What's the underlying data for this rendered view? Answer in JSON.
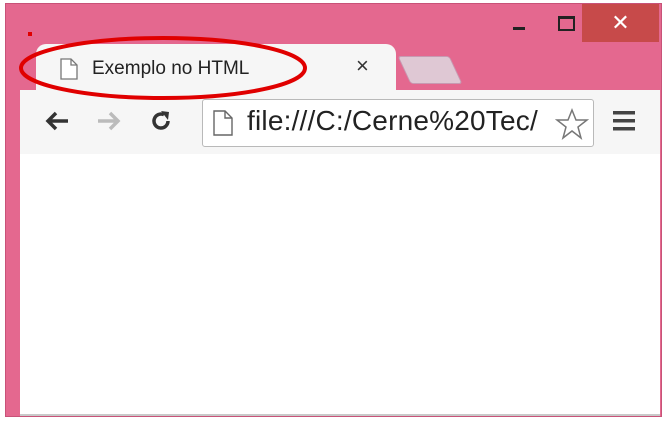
{
  "window": {
    "frame_color": "#e4688f",
    "close_color": "#c74a4a",
    "controls": {
      "minimize_icon": "minimize-icon",
      "maximize_icon": "maximize-icon",
      "close_symbol": "✕"
    }
  },
  "tab": {
    "title": "Exemplo no HTML",
    "close_symbol": "×",
    "icon": "page-icon"
  },
  "toolbar": {
    "back_icon": "back-arrow-icon",
    "forward_icon": "forward-arrow-icon",
    "reload_icon": "reload-icon",
    "url": "file:///C:/Cerne%20Tec/",
    "star_icon": "star-icon",
    "menu_icon": "hamburger-menu-icon"
  },
  "annotation": {
    "highlight_color": "#e00000"
  }
}
